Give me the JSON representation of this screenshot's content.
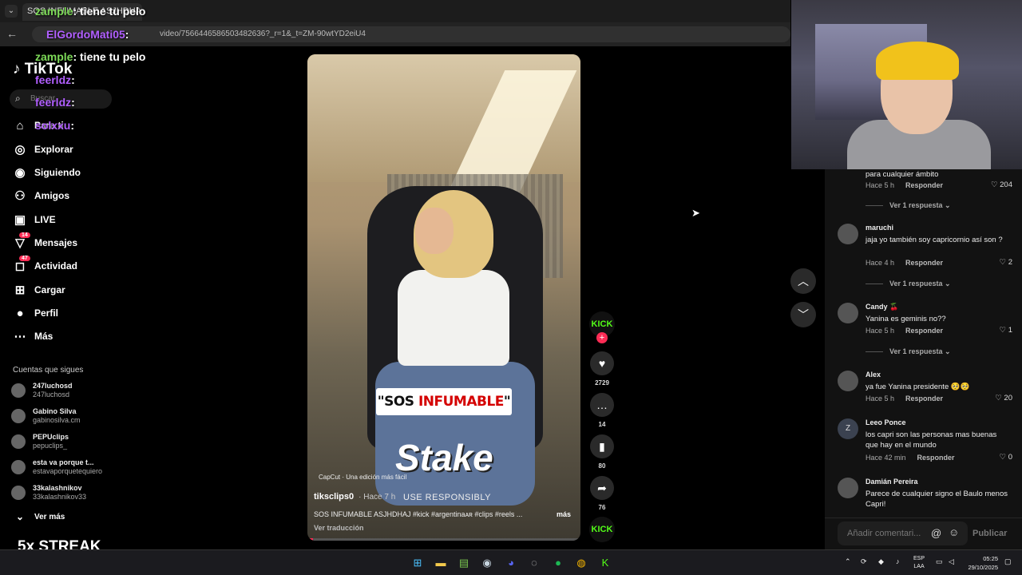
{
  "browser": {
    "tab_title": "SOS INFUMABLE ASJHDHAJ #kick...",
    "url": "video/7566446586503482636?_r=1&_t=ZM-90wtYD2eiU4"
  },
  "sidebar": {
    "logo": "TikTok",
    "search_placeholder": "Buscar",
    "items": [
      {
        "label": "Para ti",
        "icon": "home-icon"
      },
      {
        "label": "Explorar",
        "icon": "compass-icon"
      },
      {
        "label": "Siguiendo",
        "icon": "following-icon"
      },
      {
        "label": "Amigos",
        "icon": "friends-icon"
      },
      {
        "label": "LIVE",
        "icon": "live-icon"
      },
      {
        "label": "Mensajes",
        "icon": "messages-icon",
        "badge": "14"
      },
      {
        "label": "Actividad",
        "icon": "activity-icon",
        "badge": "47"
      },
      {
        "label": "Cargar",
        "icon": "upload-icon"
      },
      {
        "label": "Perfil",
        "icon": "profile-icon"
      },
      {
        "label": "Más",
        "icon": "more-icon"
      }
    ],
    "following_title": "Cuentas que sigues",
    "following": [
      {
        "name": "247luchosd",
        "handle": "247luchosd"
      },
      {
        "name": "Gabino Silva",
        "handle": "gabinosilva.cm"
      },
      {
        "name": "PEPUclips",
        "handle": "pepuclips_"
      },
      {
        "name": "esta va porque t...",
        "handle": "estavaporquetequiero"
      },
      {
        "name": "33kalashnikov",
        "handle": "33kalashnikov33"
      }
    ],
    "see_more": "Ver más"
  },
  "overlay": {
    "chat": [
      {
        "user": "zample",
        "text": ": tiene tu pelo",
        "color": "#7cd957"
      },
      {
        "user": "ElGordoMati05",
        "text": ":",
        "color": "#b15fff"
      },
      {
        "user": "zample",
        "text": ": tiene tu pelo",
        "color": "#7cd957"
      },
      {
        "user": "feerldz",
        "text": ":",
        "color": "#b15fff"
      },
      {
        "user": "feerldz",
        "text": ":",
        "color": "#b15fff"
      },
      {
        "user": "solxxu",
        "text": ":",
        "color": "#b15fff"
      }
    ],
    "streak": "5x STREAK"
  },
  "video": {
    "caption_black": "\"SOS ",
    "caption_red": "INFUMABLE",
    "caption_end": "\"",
    "brand": "Stake",
    "brand_sub": "USE RESPONSIBLY",
    "capcut": "CapCut · Una edición más fácil",
    "username": "tiksclips0",
    "time": "· Hace 7 h",
    "description": "SOS INFUMABLE ASJHDHAJ #kick #argentinaᴀʀ #clips #reels ...",
    "more": "más",
    "translate": "Ver traducción",
    "progress": 0.02
  },
  "actions": {
    "creator": "KICK",
    "likes": "2729",
    "comments": "14",
    "saves": "80",
    "shares": "76",
    "sound": "KICK"
  },
  "comments": [
    {
      "name": "",
      "text": "para cualquier ámbito",
      "time": "Hace 5 h",
      "reply": "Responder",
      "likes": "204",
      "replies": "Ver 1 respuesta"
    },
    {
      "name": "maruchi",
      "text": "jaja yo también soy capricornio así son ?",
      "time": "Hace 4 h",
      "reply": "Responder",
      "likes": "2",
      "replies": "Ver 1 respuesta"
    },
    {
      "name": "Candy 🍒",
      "text": "Yanina es geminis no??",
      "time": "Hace 5 h",
      "reply": "Responder",
      "likes": "1",
      "replies": "Ver 1 respuesta"
    },
    {
      "name": "Alex",
      "text": "ya fue Yanina presidente 🥺🥺",
      "time": "Hace 5 h",
      "reply": "Responder",
      "likes": "20"
    },
    {
      "name": "Leeo Ponce",
      "text": "los capri son las personas mas buenas que hay en el mundo",
      "time": "Hace 42 min",
      "reply": "Responder",
      "likes": "0",
      "avatar_letter": "Z"
    },
    {
      "name": "Damián Pereira",
      "text": "Parece de cualquier signo el Baulo menos Capri!"
    }
  ],
  "comment_input": {
    "placeholder": "Añadir comentari...",
    "at": "@",
    "post": "Publicar"
  },
  "taskbar": {
    "lang_1": "ESP",
    "lang_2": "LAA",
    "time": "05:25",
    "date": "29/10/2025"
  },
  "colors": {
    "accent": "#fe2c55",
    "kick": "#53fc18"
  }
}
